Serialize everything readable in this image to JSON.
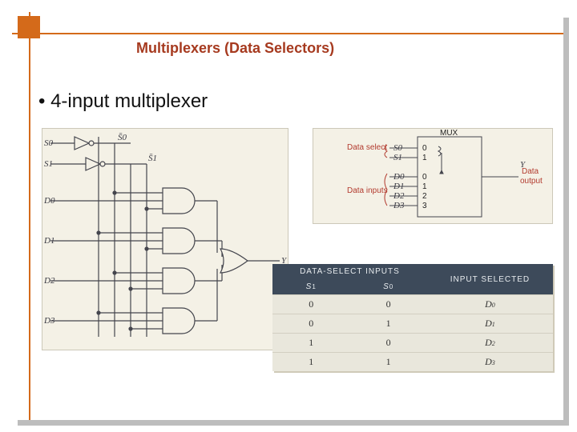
{
  "title": "Multiplexers (Data Selectors)",
  "bullet": "4-input multiplexer",
  "circuit": {
    "inputs_select": [
      "S0",
      "S1"
    ],
    "select_bar": [
      "S̄0",
      "S̄1"
    ],
    "inputs_data": [
      "D0",
      "D1",
      "D2",
      "D3"
    ],
    "output": "Y"
  },
  "mux_block": {
    "block_label": "MUX",
    "data_select_label": "Data select",
    "data_inputs_label": "Data inputs",
    "output_label": "Data output",
    "select_pins": [
      "S0",
      "S1"
    ],
    "select_idx": [
      "0",
      "1"
    ],
    "data_pins": [
      "D0",
      "D1",
      "D2",
      "D3"
    ],
    "data_idx": [
      "0",
      "1",
      "2",
      "3"
    ],
    "output_pin": "Y"
  },
  "truth_table": {
    "header_group": "DATA-SELECT INPUTS",
    "header_s1": "S1",
    "header_s0": "S0",
    "header_sel": "INPUT SELECTED",
    "rows": [
      {
        "s1": "0",
        "s0": "0",
        "out": "D0"
      },
      {
        "s1": "0",
        "s0": "1",
        "out": "D1"
      },
      {
        "s1": "1",
        "s0": "0",
        "out": "D2"
      },
      {
        "s1": "1",
        "s0": "1",
        "out": "D3"
      }
    ]
  }
}
